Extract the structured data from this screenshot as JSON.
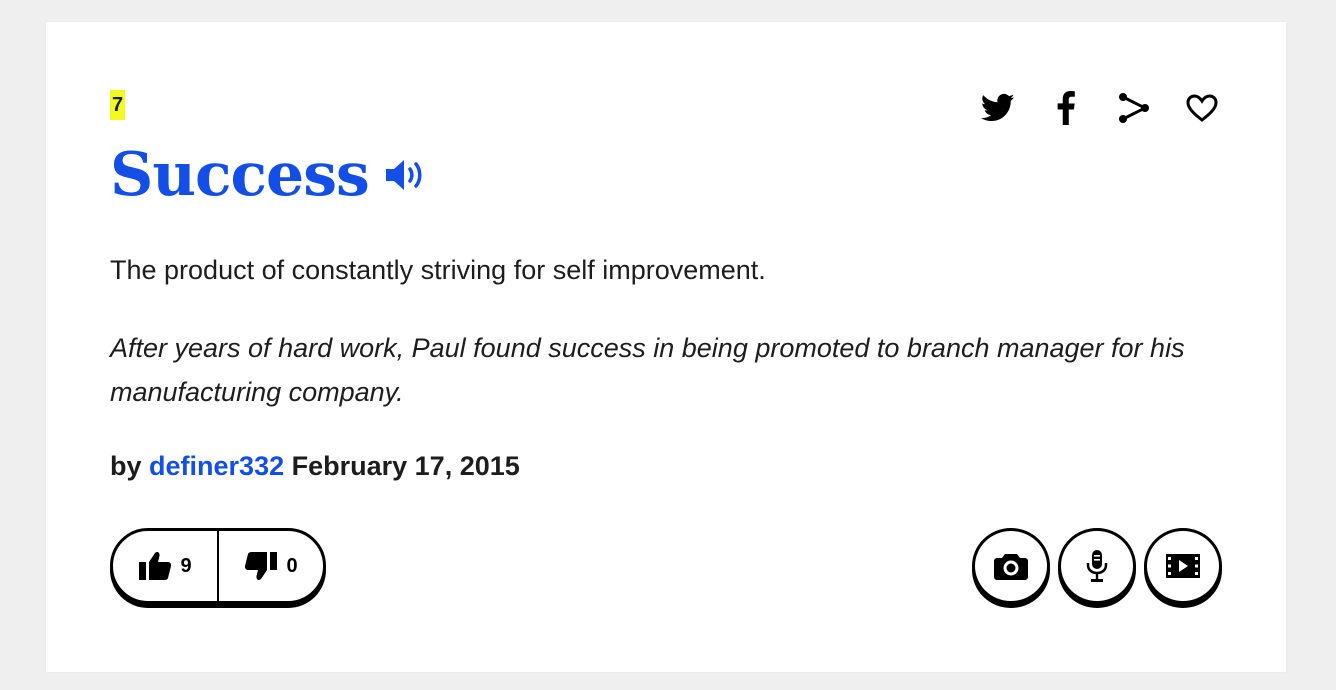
{
  "entry": {
    "rank": "7",
    "word": "Success",
    "meaning": "The product of constantly striving for self improvement.",
    "example": "After years of hard work, Paul found success in being promoted to branch manager for his manufacturing company.",
    "by_label": "by",
    "author": "definer332",
    "date": "February 17, 2015"
  },
  "share_icons": [
    "twitter-icon",
    "facebook-icon",
    "share-icon",
    "heart-icon"
  ],
  "votes": {
    "up": "9",
    "down": "0"
  },
  "media_buttons": [
    "camera-icon",
    "microphone-icon",
    "video-icon"
  ],
  "colors": {
    "link": "#134fe6",
    "rank_highlight": "#f2fb1e",
    "text": "#1d1d1d",
    "background": "#efefef"
  }
}
